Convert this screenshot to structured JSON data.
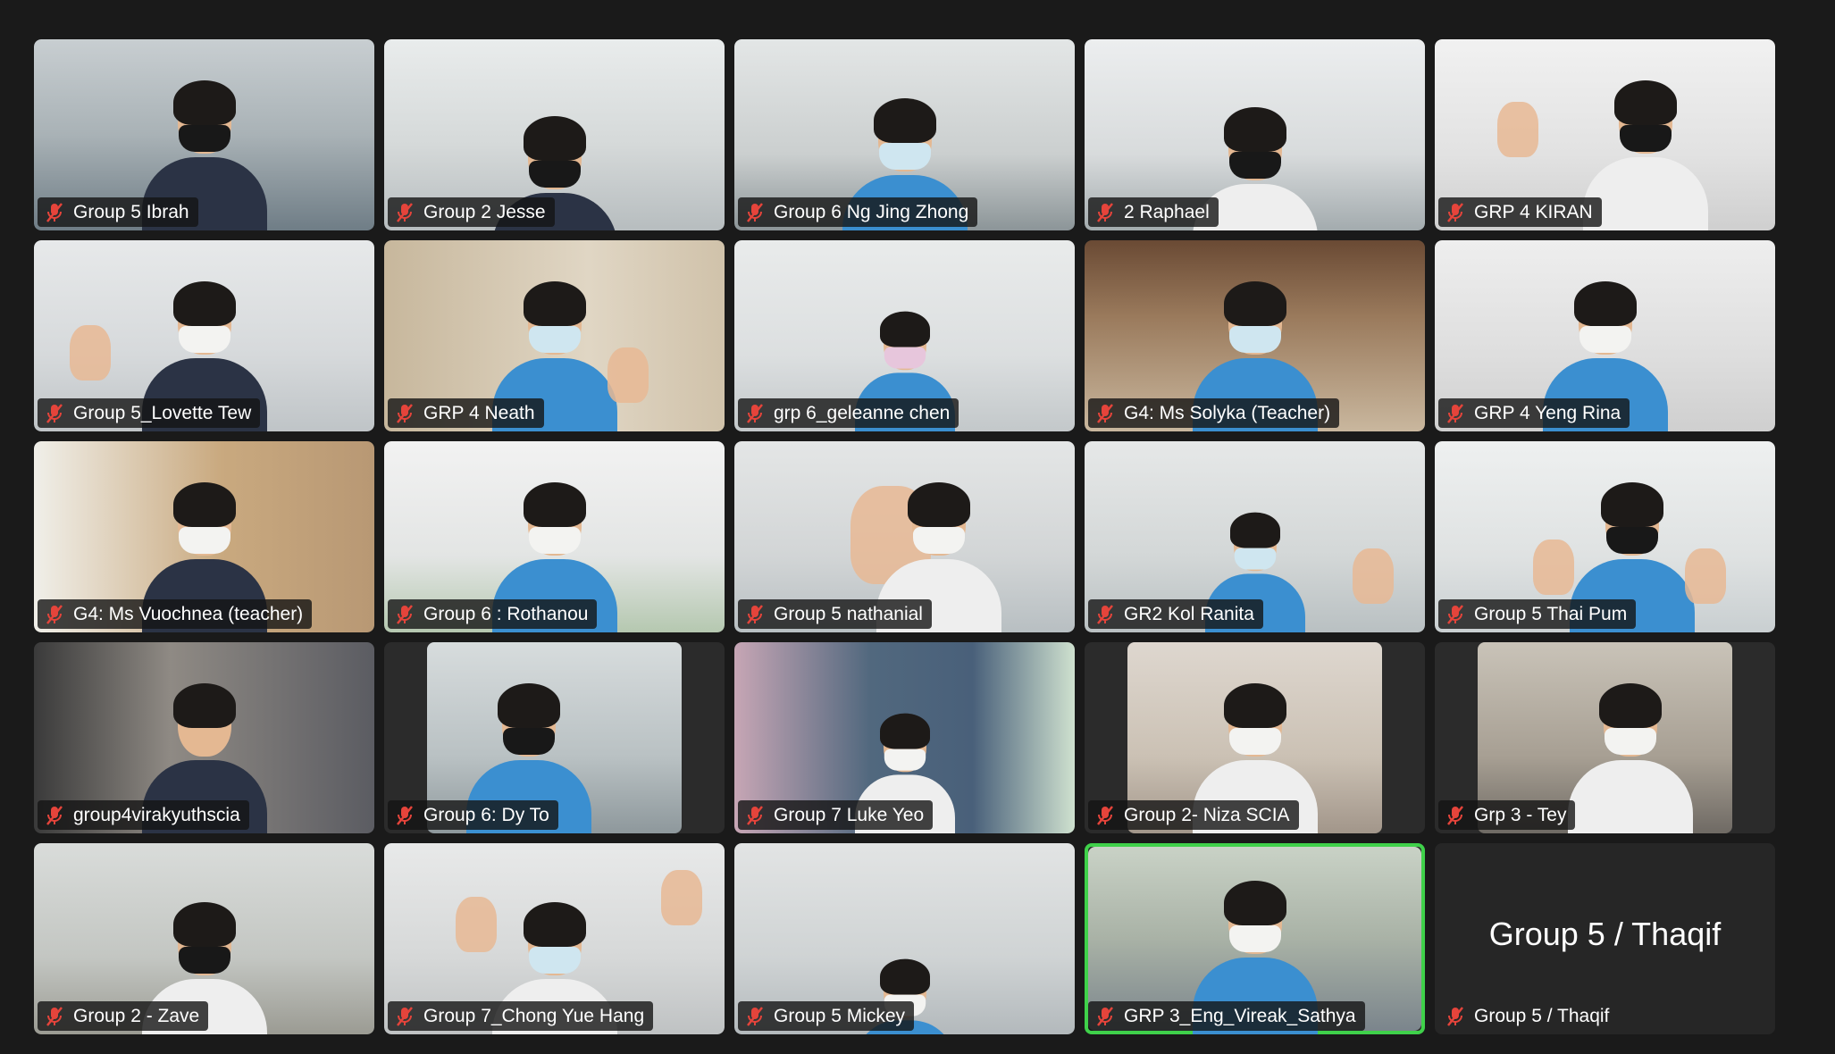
{
  "meeting": {
    "muted_icon": "mic-muted-icon",
    "muted_color": "#e5443b",
    "active_speaker_color": "#3fd14a"
  },
  "participants": [
    {
      "name": "Group 5 Ibrah"
    },
    {
      "name": "Group 2 Jesse"
    },
    {
      "name": "Group 6 Ng Jing Zhong"
    },
    {
      "name": "2 Raphael"
    },
    {
      "name": "GRP 4 KIRAN"
    },
    {
      "name": "Group 5_Lovette Tew"
    },
    {
      "name": "GRP 4 Neath"
    },
    {
      "name": "grp 6_geleanne chen"
    },
    {
      "name": "G4: Ms Solyka (Teacher)"
    },
    {
      "name": "GRP 4 Yeng Rina"
    },
    {
      "name": "G4: Ms Vuochnea (teacher)"
    },
    {
      "name": "Group 6 : Rothanou"
    },
    {
      "name": "Group 5 nathanial"
    },
    {
      "name": "GR2 Kol Ranita"
    },
    {
      "name": "Group 5 Thai Pum"
    },
    {
      "name": "group4virakyuthscia"
    },
    {
      "name": "Group 6: Dy To"
    },
    {
      "name": "Group 7 Luke Yeo"
    },
    {
      "name": "Group 2- Niza SCIA"
    },
    {
      "name": "Grp 3 - Tey"
    },
    {
      "name": "Group 2 - Zave"
    },
    {
      "name": "Group 7_Chong Yue Hang"
    },
    {
      "name": "Group 5 Mickey"
    },
    {
      "name": "GRP 3_Eng_Vireak_Sathya"
    },
    {
      "name": "Group 5 / Thaqif",
      "video_off_label": "Group 5 / Thaqif"
    }
  ]
}
